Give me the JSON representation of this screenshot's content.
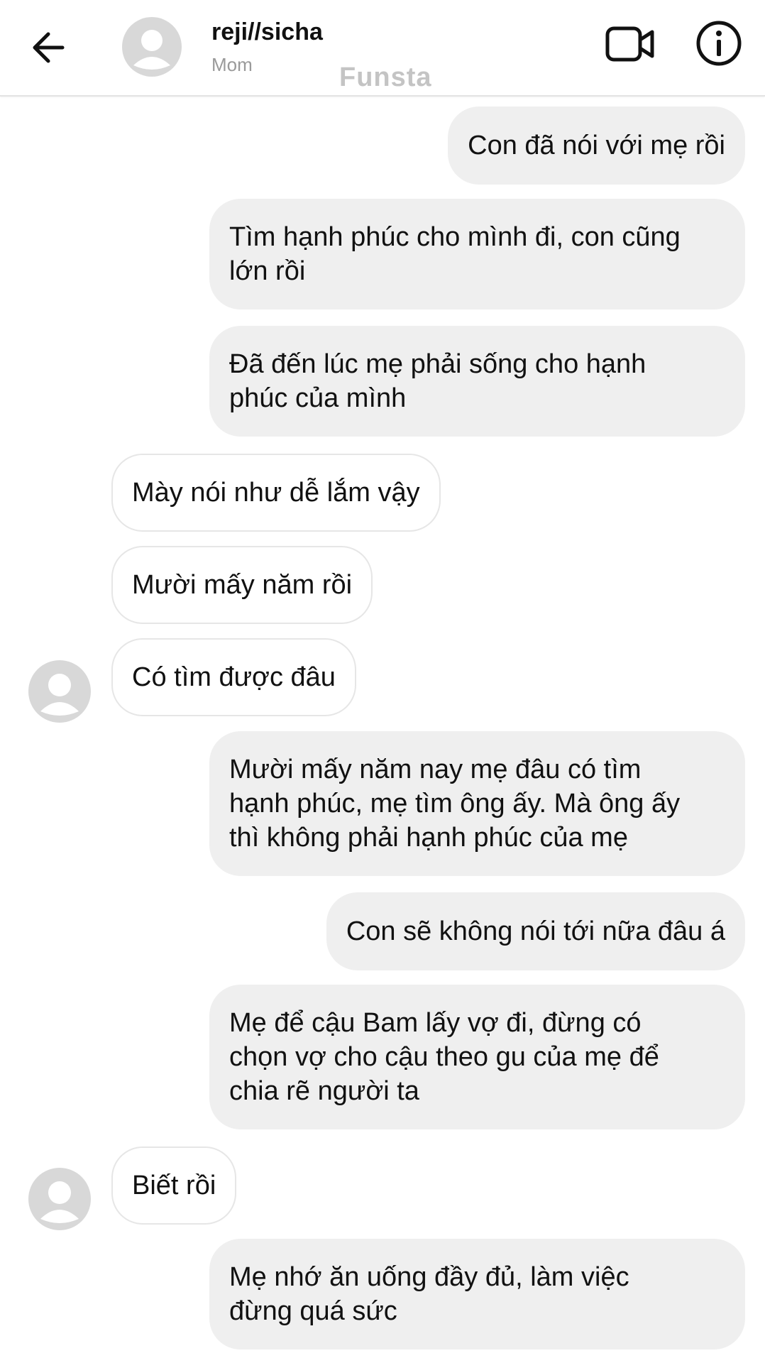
{
  "header": {
    "contact_name": "reji//sicha",
    "contact_subtitle": "Mom",
    "watermark": "Funsta",
    "icons": [
      "back-arrow-icon",
      "profile-avatar-icon",
      "video-call-icon",
      "info-icon"
    ]
  },
  "messages": [
    {
      "from": "me",
      "text": "Con đã nói với mẹ rồi"
    },
    {
      "from": "me",
      "text": "Tìm hạnh phúc cho mình đi, con cũng\nlớn rồi"
    },
    {
      "from": "me",
      "text": "Đã đến lúc mẹ phải sống cho hạnh\nphúc của mình"
    },
    {
      "from": "them",
      "text": "Mày nói như dễ lắm vậy"
    },
    {
      "from": "them",
      "text": "Mười mấy năm rồi"
    },
    {
      "from": "them",
      "text": "Có tìm được đâu"
    },
    {
      "from": "me",
      "text": "Mười mấy năm nay mẹ đâu có tìm\nhạnh phúc, mẹ tìm ông ấy. Mà ông ấy\nthì không phải hạnh phúc của mẹ"
    },
    {
      "from": "me",
      "text": "Con sẽ không nói tới nữa đâu á"
    },
    {
      "from": "me",
      "text": "Mẹ để cậu Bam lấy vợ đi, đừng có\nchọn vợ cho cậu theo gu của mẹ để\nchia rẽ người ta"
    },
    {
      "from": "them",
      "text": "Biết rồi"
    },
    {
      "from": "me",
      "text": "Mẹ nhớ ăn uống đầy đủ, làm việc\nđừng quá sức"
    }
  ],
  "colors": {
    "sent_bubble": "#efefef",
    "received_bubble_border": "#e6e6e6",
    "avatar_placeholder": "#d8d8d8",
    "watermark": "#c4c4c4"
  }
}
